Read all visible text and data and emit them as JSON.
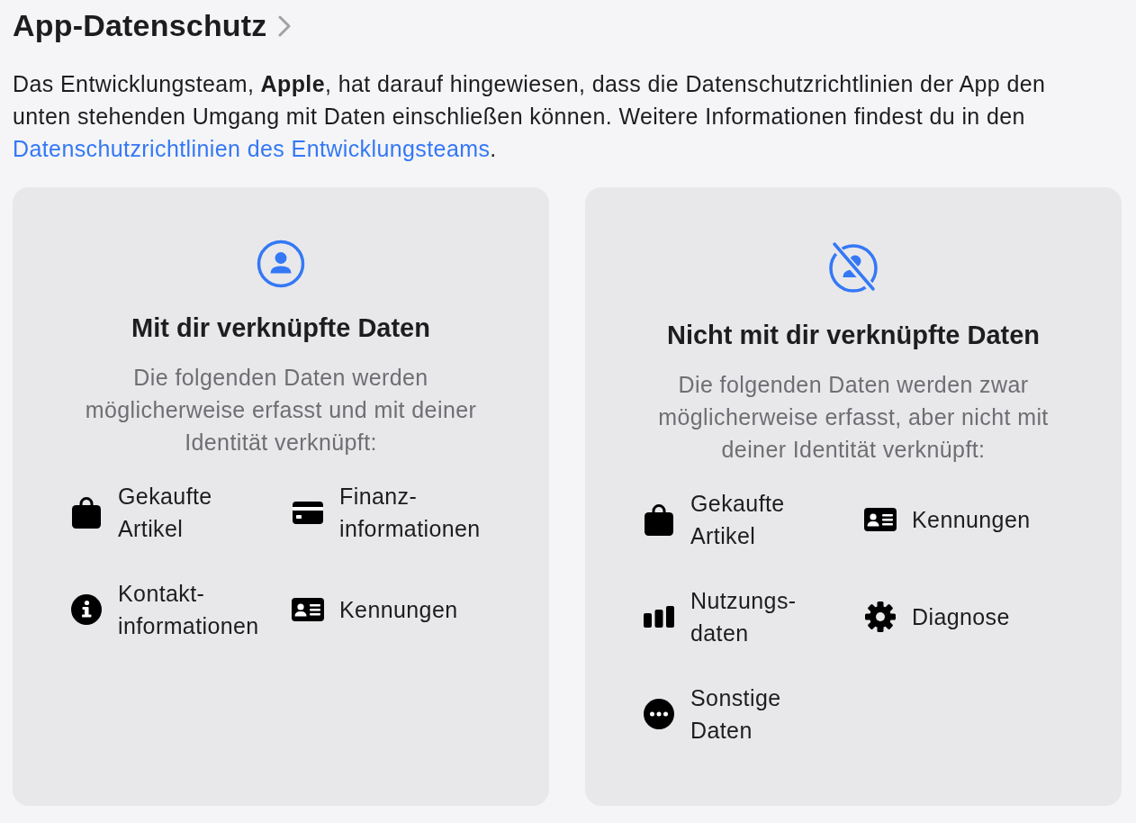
{
  "header": {
    "title": "App-Datenschutz"
  },
  "intro": {
    "text": "Das Entwicklungsteam, **Apple**, hat darauf hingewiesen, dass die Datenschutzrichtlinien der App den unten stehenden Umgang mit Daten einschließen können. Weitere Informationen findest du in den",
    "link": "Datenschutzrichtlinien des Entwicklungsteams",
    "after": "."
  },
  "cards": [
    {
      "kind": "linked",
      "title": "Mit dir verknüpfte Daten",
      "description": "Die folgenden Daten werden möglicherweise erfasst und mit deiner Identität verknüpft:",
      "items": [
        {
          "kind": "purchases",
          "label": "Gekaufte Artikel"
        },
        {
          "kind": "financial",
          "label": "Finanz-informationen"
        },
        {
          "kind": "contact",
          "label": "Kontakt-informationen"
        },
        {
          "kind": "identifiers",
          "label": "Kennungen"
        }
      ]
    },
    {
      "kind": "not_linked",
      "title": "Nicht mit dir verknüpfte Daten",
      "description": "Die folgenden Daten werden zwar möglicherweise erfasst, aber nicht mit deiner Identität verknüpft:",
      "items": [
        {
          "kind": "purchases",
          "label": "Gekaufte Artikel"
        },
        {
          "kind": "identifiers",
          "label": "Kennungen"
        },
        {
          "kind": "usage",
          "label": "Nutzungs-daten"
        },
        {
          "kind": "diagnostics",
          "label": "Diagnose"
        },
        {
          "kind": "other",
          "label": "Sonstige Daten"
        }
      ]
    }
  ]
}
